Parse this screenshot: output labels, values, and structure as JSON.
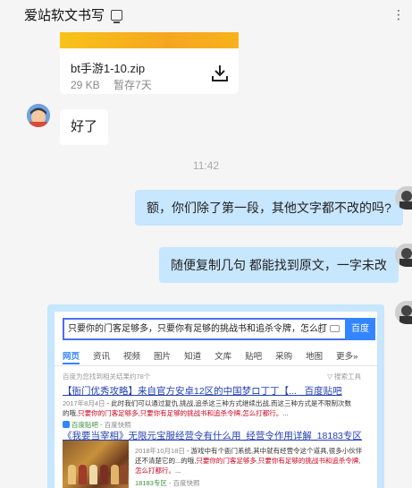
{
  "header": {
    "title": "爱站软文书写",
    "more": "⋮"
  },
  "file": {
    "name": "bt手游1-10.zip",
    "size": "29 KB",
    "status": "暂存7天"
  },
  "messages": {
    "left_1": "好了",
    "time": "11:42",
    "right_1": "额，你们除了第一段，其他文字都不改的吗?",
    "right_2": "随便复制几句  都能找到原文，一字未改"
  },
  "baidu": {
    "query": "只要你的门客足够多，只要你有足够的挑战书和追杀令牌，怎么打",
    "search_button": "百度",
    "tabs": [
      "网页",
      "资讯",
      "视频",
      "图片",
      "知道",
      "文库",
      "贴吧",
      "采购",
      "地图",
      "更多»"
    ],
    "result_count": "百度为您找到相关结果约78个",
    "tools": "搜索工具",
    "results": [
      {
        "title": "【衙门优秀攻略】来自官方安卓12区的中国梦ロ丁丁【... _百度贴吧",
        "date": "2017年8月4日",
        "desc_a": " - 此时我们可以通过复仇,挑战,追杀这三种方式继续出战,而这三种方式是不限制次数的哦,",
        "desc_red": "只要你的门客足够多,只要你有足够的挑战书和追杀令牌,怎么打都行。",
        "desc_b": "...",
        "source": "百度贴吧",
        "snapshot": "百度快照"
      },
      {
        "title": "《我要当宰相》无限元宝服经营令有什么用_经营令作用详解_18183专区",
        "date": "2018年10月18日",
        "desc_a": " - 游戏中有个衙门系统,其中就有经营令这个道具,很多小伙伴还不清楚它的...的哦,",
        "desc_red": "只要你的门客足够多,只要你有足够的挑战书和追杀令牌,怎么打都行。",
        "desc_b": "...",
        "source": "18183专区",
        "snapshot": "百度快照"
      }
    ]
  },
  "colors": {
    "bubble_self": "#c7e6ff",
    "bubble_other": "#ffffff",
    "file_banner": "#f6a61e",
    "baidu_blue": "#3385ff",
    "link_blue": "#2440b3",
    "highlight_red": "#d0021b"
  }
}
